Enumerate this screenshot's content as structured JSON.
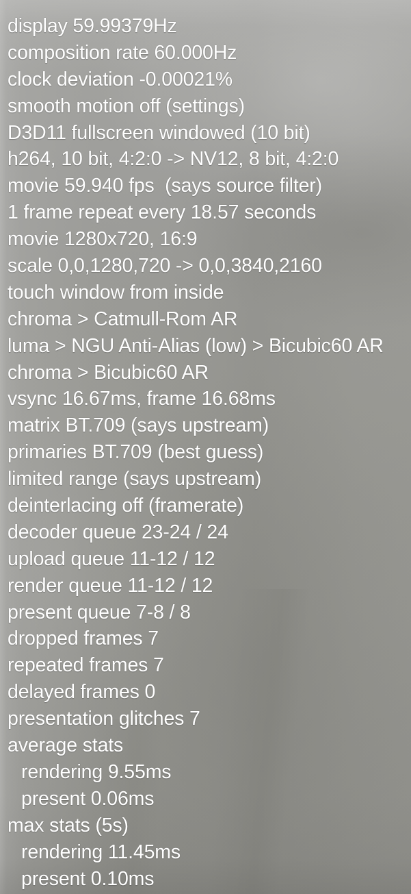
{
  "overlay": {
    "name": "madVR rendering statistics OSD",
    "text_color": "#ffffff",
    "background_color": "#9b9b97",
    "lines": [
      {
        "text": "display 59.99379Hz",
        "indent": false
      },
      {
        "text": "composition rate 60.000Hz",
        "indent": false
      },
      {
        "text": "clock deviation -0.00021%",
        "indent": false
      },
      {
        "text": "smooth motion off (settings)",
        "indent": false
      },
      {
        "text": "D3D11 fullscreen windowed (10 bit)",
        "indent": false
      },
      {
        "text": "h264, 10 bit, 4:2:0 -> NV12, 8 bit, 4:2:0",
        "indent": false
      },
      {
        "text": "movie 59.940 fps  (says source filter)",
        "indent": false
      },
      {
        "text": "1 frame repeat every 18.57 seconds",
        "indent": false
      },
      {
        "text": "movie 1280x720, 16:9",
        "indent": false
      },
      {
        "text": "scale 0,0,1280,720 -> 0,0,3840,2160",
        "indent": false
      },
      {
        "text": "touch window from inside",
        "indent": false
      },
      {
        "text": "chroma > Catmull-Rom AR",
        "indent": false
      },
      {
        "text": "luma > NGU Anti-Alias (low) > Bicubic60 AR",
        "indent": false
      },
      {
        "text": "chroma > Bicubic60 AR",
        "indent": false
      },
      {
        "text": "vsync 16.67ms, frame 16.68ms",
        "indent": false
      },
      {
        "text": "matrix BT.709 (says upstream)",
        "indent": false
      },
      {
        "text": "primaries BT.709 (best guess)",
        "indent": false
      },
      {
        "text": "limited range (says upstream)",
        "indent": false
      },
      {
        "text": "deinterlacing off (framerate)",
        "indent": false
      },
      {
        "text": "decoder queue 23-24 / 24",
        "indent": false
      },
      {
        "text": "upload queue 11-12 / 12",
        "indent": false
      },
      {
        "text": "render queue 11-12 / 12",
        "indent": false
      },
      {
        "text": "present queue 7-8 / 8",
        "indent": false
      },
      {
        "text": "dropped frames 7",
        "indent": false
      },
      {
        "text": "repeated frames 7",
        "indent": false
      },
      {
        "text": "delayed frames 0",
        "indent": false
      },
      {
        "text": "presentation glitches 7",
        "indent": false
      },
      {
        "text": "average stats",
        "indent": false
      },
      {
        "text": "rendering 9.55ms",
        "indent": true
      },
      {
        "text": "present 0.06ms",
        "indent": true
      },
      {
        "text": "max stats (5s)",
        "indent": false
      },
      {
        "text": "rendering 11.45ms",
        "indent": true
      },
      {
        "text": "present 0.10ms",
        "indent": true
      }
    ]
  }
}
